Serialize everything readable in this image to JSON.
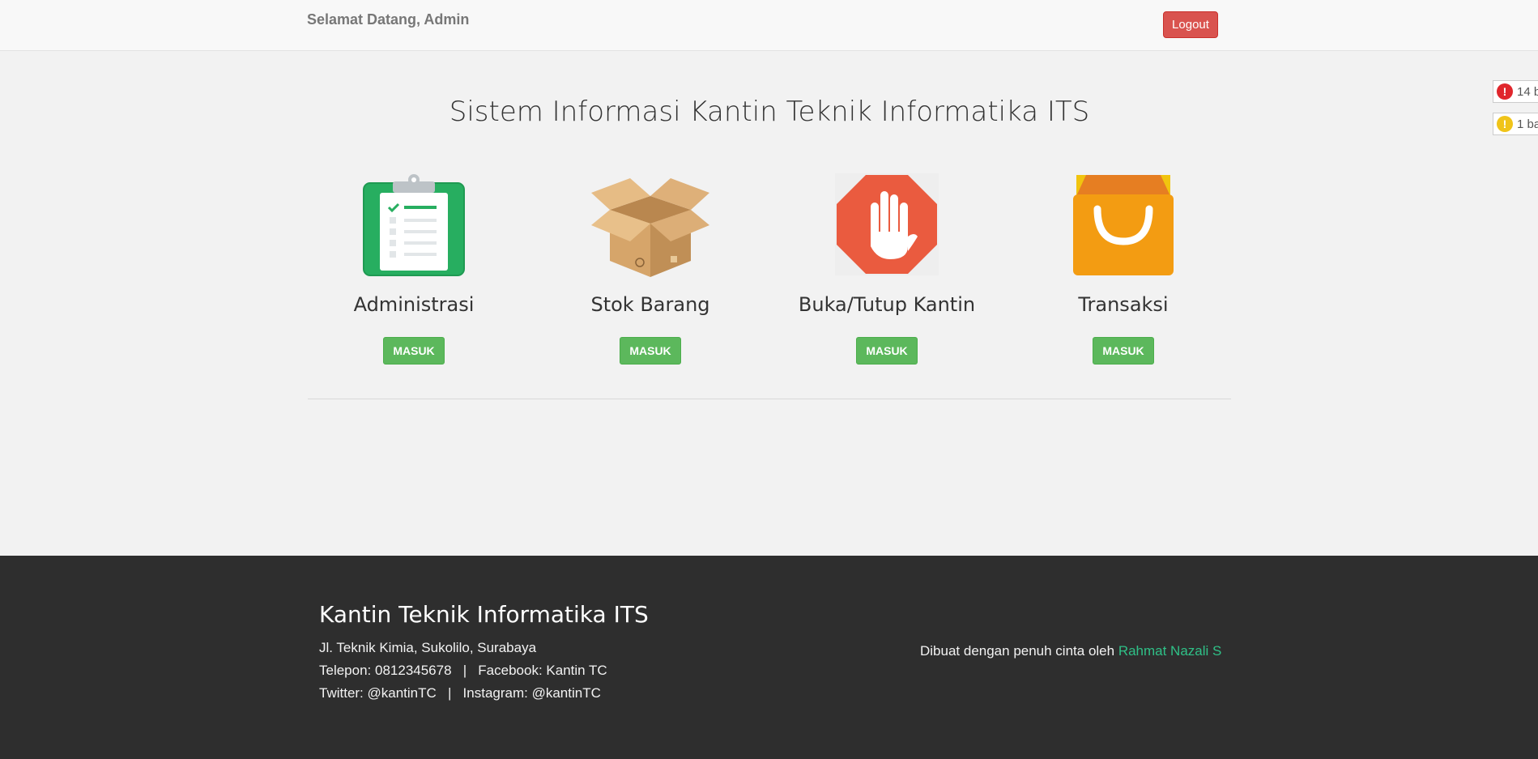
{
  "header": {
    "welcome": "Selamat Datang, Admin",
    "logout_label": "Logout"
  },
  "main": {
    "title": "Sistem Informasi Kantin Teknik Informatika ITS",
    "cards": [
      {
        "label": "Administrasi",
        "icon": "clipboard-icon",
        "button": "MASUK"
      },
      {
        "label": "Stok Barang",
        "icon": "box-icon",
        "button": "MASUK"
      },
      {
        "label": "Buka/Tutup Kantin",
        "icon": "stop-hand-icon",
        "button": "MASUK"
      },
      {
        "label": "Transaksi",
        "icon": "shopping-bag-icon",
        "button": "MASUK"
      }
    ]
  },
  "footer": {
    "title": "Kantin Teknik Informatika ITS",
    "address": "Jl. Teknik Kimia, Sukolilo, Surabaya",
    "contact": "Telepon: 0812345678   |   Facebook: Kantin TC",
    "social": "Twitter: @kantinTC   |   Instagram: @kantinTC",
    "credit_prefix": "Dibuat dengan penuh cinta oleh ",
    "credit_name": "Rahmat Nazali S"
  },
  "notifications": [
    {
      "text": "14 b",
      "color": "#e0262c",
      "symbol": "!"
    },
    {
      "text": "1 ba",
      "color": "#f0c419",
      "symbol": "!"
    }
  ],
  "colors": {
    "primary_green": "#5cb85c",
    "logout_red": "#d9534f",
    "footer_bg": "#2e2e2e",
    "credit_link": "#2fc087"
  }
}
